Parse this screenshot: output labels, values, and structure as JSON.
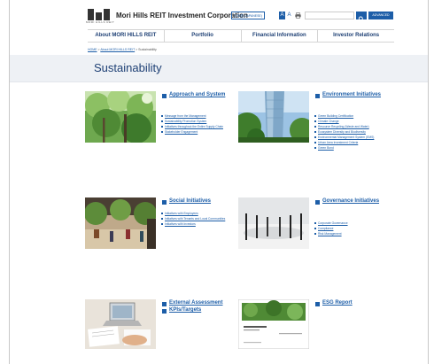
{
  "header": {
    "brand_sub": "MORI HILLS REIT",
    "site_title": "Mori Hills REIT Investment Corporation",
    "lang_button": "日本語 (JAPANESE)",
    "font_size_label": "",
    "font_small": "A",
    "font_large": "A",
    "search_placeholder": "",
    "advanced_button": "ADVANCED"
  },
  "nav": {
    "items": [
      {
        "label": "About MORI HILLS REIT"
      },
      {
        "label": "Portfolio"
      },
      {
        "label": "Financial Information"
      },
      {
        "label": "Investor Relations"
      }
    ]
  },
  "breadcrumb": {
    "home": "HOME",
    "about": "About MORI HILLS REIT",
    "current": "Sustainability",
    "separator": ">"
  },
  "page": {
    "title": "Sustainability"
  },
  "sections": {
    "approach": {
      "title": "Approach and System",
      "links": [
        "Message from the Management",
        "Sustainability Promotion System",
        "Initiatives throughout the Entire Supply Chain",
        "Stakeholder Engagement"
      ]
    },
    "environment": {
      "title": "Environment Initiatives",
      "links": [
        "Green Building Certification",
        "Climate Change",
        "Resource Recycling (Waste and Water)",
        "Ecosystem Diversity and Biodiversity",
        "Environmental Management System (EMS)",
        "Urban Area Investment Criteria",
        "Green Bond"
      ]
    },
    "social": {
      "title": "Social Initiatives",
      "links": [
        "Initiatives with Employees",
        "Initiatives with Tenants and Local Communities",
        "Initiatives with Investors"
      ]
    },
    "governance": {
      "title": "Governance Initiatives",
      "links": [
        "Corporate Governance",
        "Compliance",
        "Risk Management"
      ]
    },
    "external": {
      "title": "External Assessment"
    },
    "kpis": {
      "title": "KPIs/Targets"
    },
    "esg": {
      "title": "ESG Report"
    }
  },
  "colors": {
    "brand_blue": "#1d5ea8",
    "nav_text": "#1d3f74",
    "title_band": "#eef1f5"
  }
}
